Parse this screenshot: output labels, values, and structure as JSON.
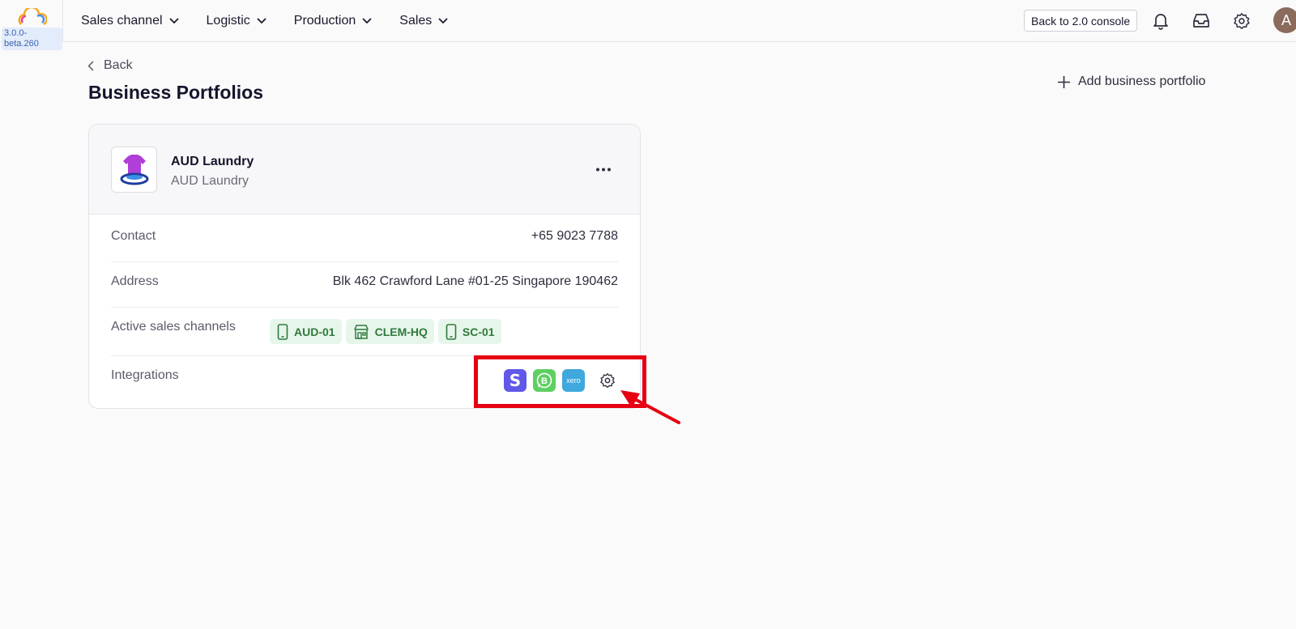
{
  "app": {
    "version": "3.0.0-beta.260"
  },
  "nav": {
    "items": [
      {
        "label": "Sales channel"
      },
      {
        "label": "Logistic"
      },
      {
        "label": "Production"
      },
      {
        "label": "Sales"
      }
    ]
  },
  "topbar": {
    "console_button": "Back to 2.0 console",
    "icons": [
      "bell-icon",
      "inbox-icon",
      "gear-icon"
    ],
    "avatar_initial": "A"
  },
  "page": {
    "back_label": "Back",
    "title": "Business Portfolios",
    "add_button": "Add business portfolio"
  },
  "portfolio": {
    "name": "AUD Laundry",
    "subtitle": "AUD Laundry",
    "rows": {
      "contact_label": "Contact",
      "contact_value": "+65 9023 7788",
      "address_label": "Address",
      "address_value": "Blk 462 Crawford Lane #01-25 Singapore 190462",
      "channels_label": "Active sales channels",
      "integrations_label": "Integrations"
    },
    "channels": [
      {
        "label": "AUD-01",
        "icon": "mobile-icon"
      },
      {
        "label": "CLEM-HQ",
        "icon": "store-icon"
      },
      {
        "label": "SC-01",
        "icon": "mobile-icon"
      }
    ],
    "integrations": [
      {
        "name": "stripe-icon",
        "glyph": "S",
        "color": "#6058e8"
      },
      {
        "name": "whatsapp-business-icon",
        "glyph": "B",
        "color": "#5fcf63"
      },
      {
        "name": "xero-icon",
        "glyph": "xero",
        "color": "#3fa8dc"
      }
    ]
  },
  "annotation": {
    "color": "#e60012"
  }
}
